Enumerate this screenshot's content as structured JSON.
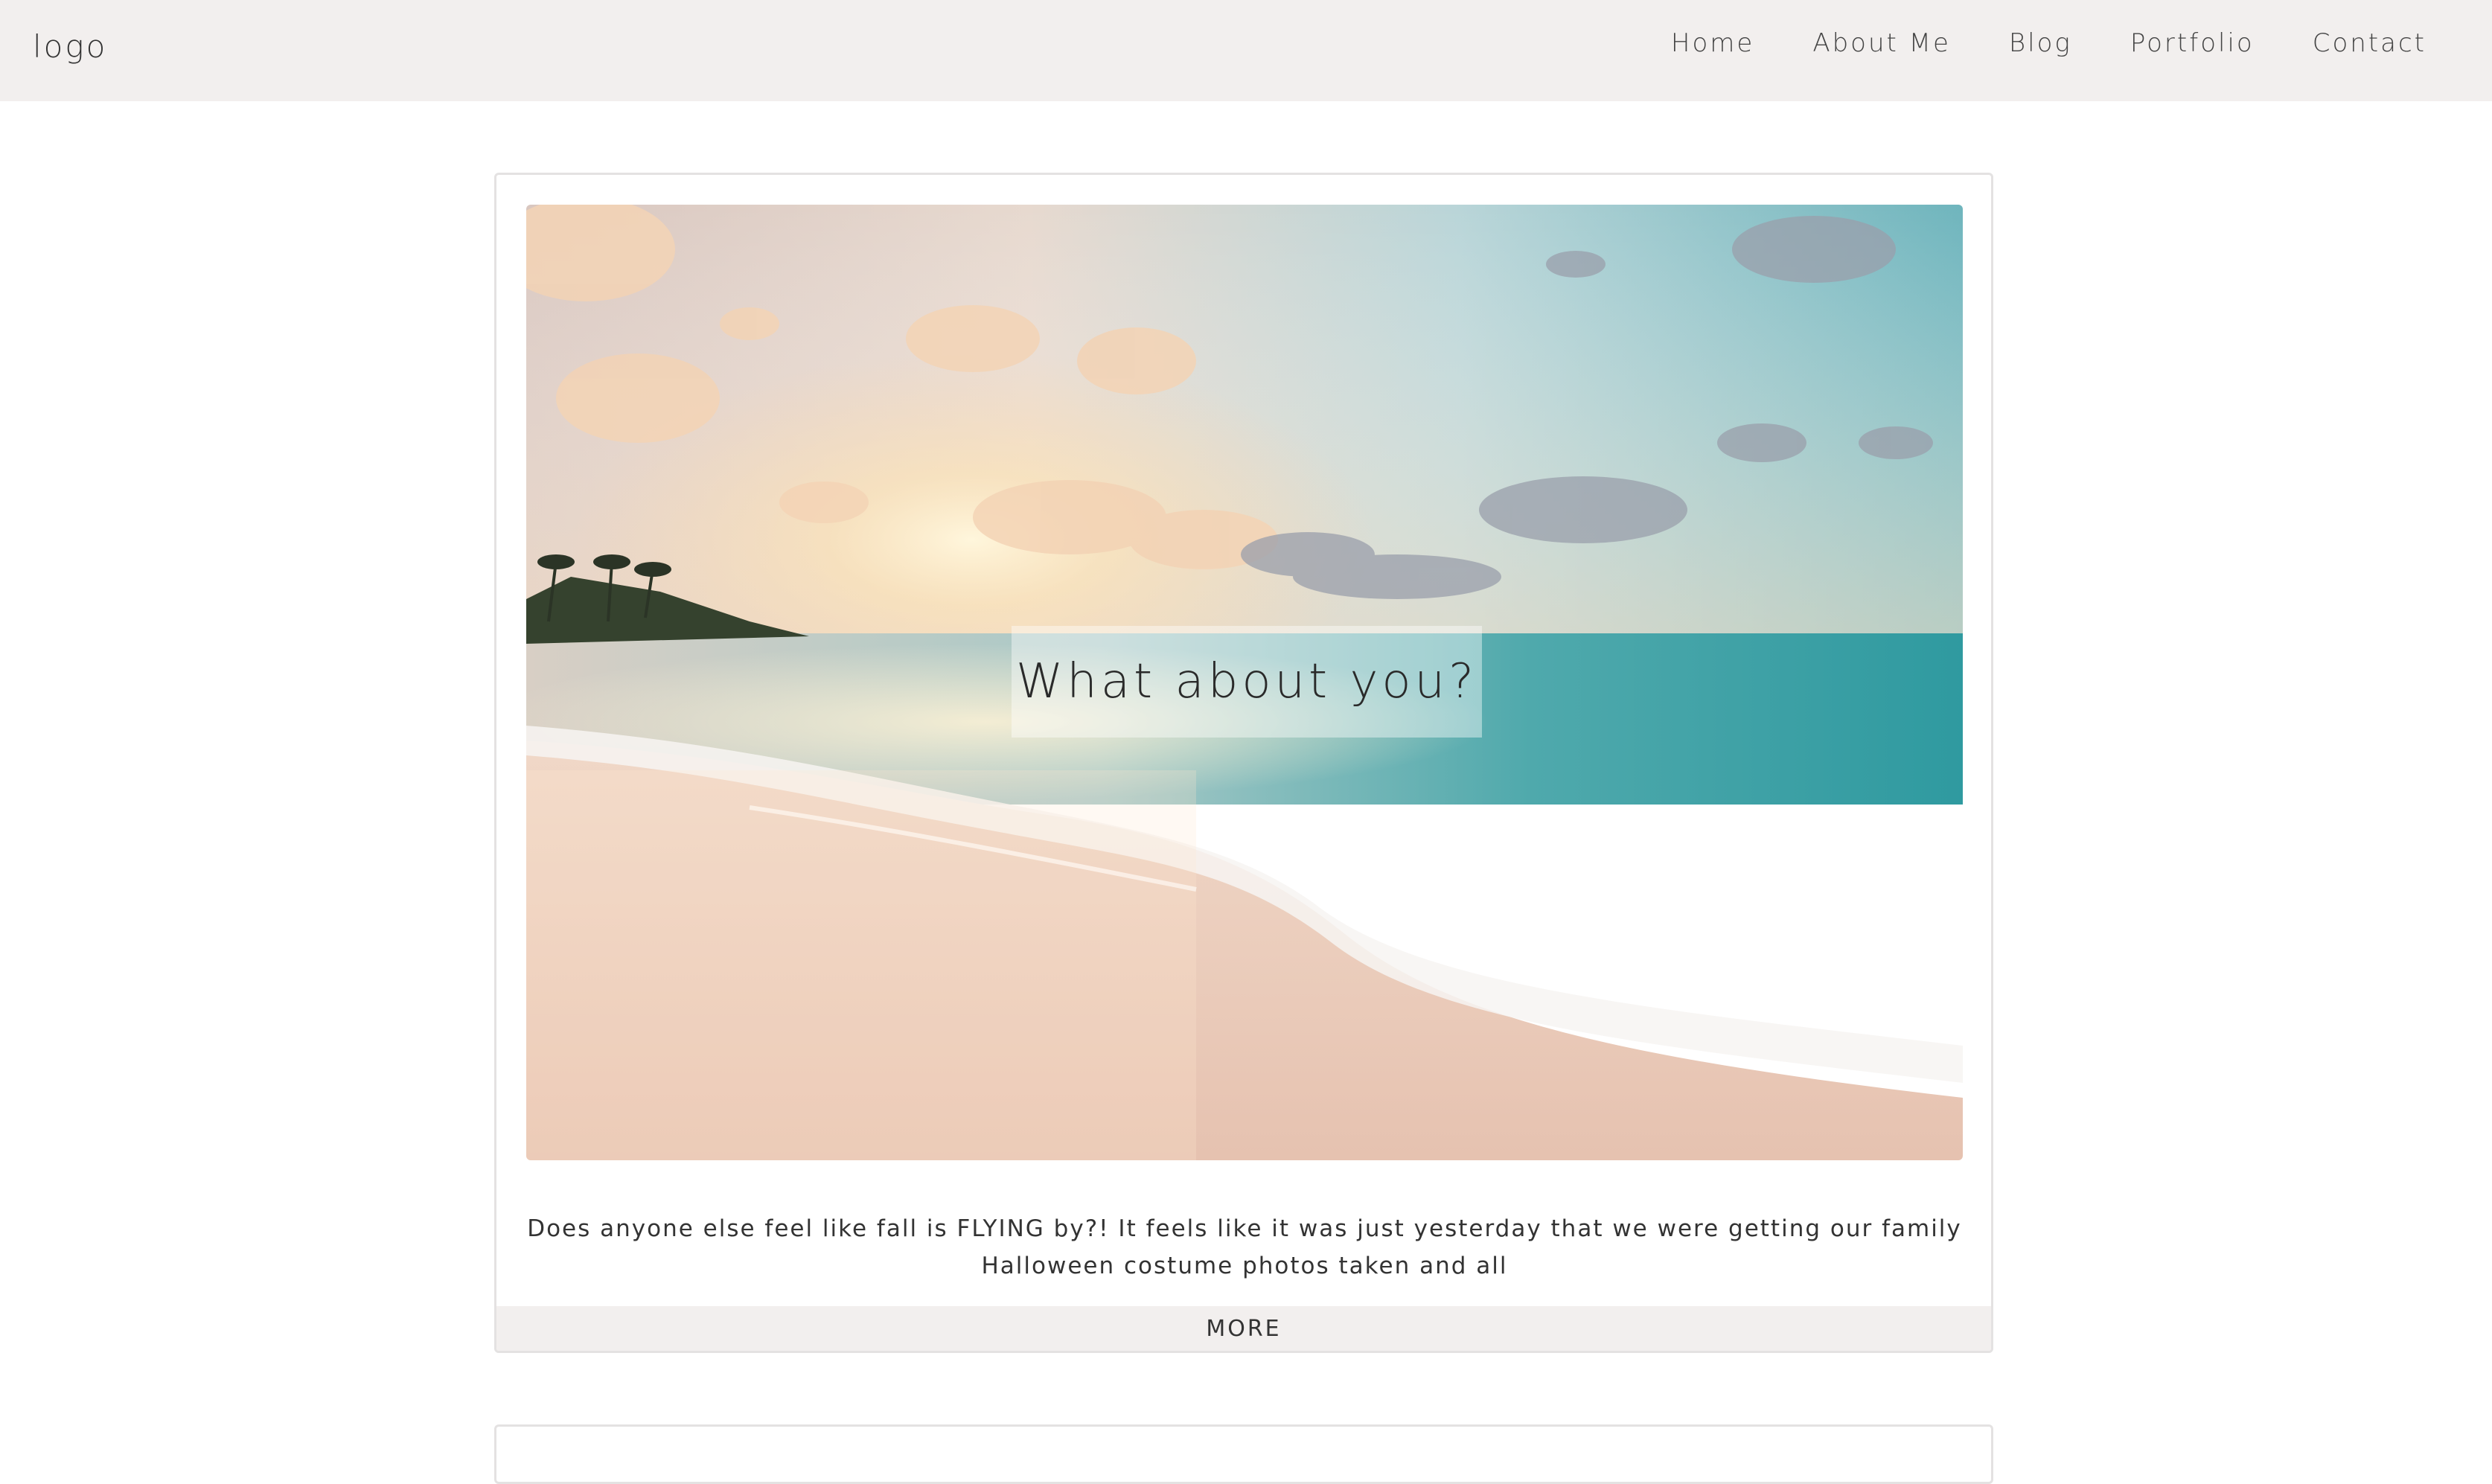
{
  "header": {
    "logo": "logo",
    "nav": [
      {
        "label": "Home"
      },
      {
        "label": "About Me"
      },
      {
        "label": "Blog"
      },
      {
        "label": "Portfolio"
      },
      {
        "label": "Contact"
      }
    ]
  },
  "post": {
    "title": "What about you?",
    "excerpt": "Does anyone else feel like fall is FLYING by?! It feels like it was just yesterday that we were getting our family Halloween costume photos taken and all",
    "more_label": "MORE"
  }
}
